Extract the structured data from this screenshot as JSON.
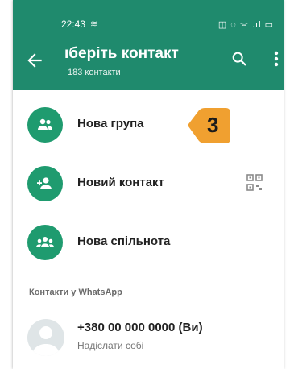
{
  "status_bar": {
    "time": "22:43",
    "icons_text": "◫ ◌ ᯤ .ıl ▭"
  },
  "header": {
    "title": "ıберіть контакт",
    "subtitle": "183 контакти"
  },
  "actions": [
    {
      "label": "Нова група",
      "icon": "group-icon"
    },
    {
      "label": "Новий контакт",
      "icon": "add-person-icon"
    },
    {
      "label": "Нова спільнота",
      "icon": "community-icon"
    }
  ],
  "section_header": "Контакти у WhatsApp",
  "contact": {
    "name": "+380 00 000 0000 (Ви)",
    "subtitle": "Надіслати собі"
  },
  "annotation": {
    "step": "3"
  },
  "colors": {
    "app_bar": "#1f8a6d",
    "action_avatar": "#1f9b6f",
    "badge": "#f0a030"
  }
}
